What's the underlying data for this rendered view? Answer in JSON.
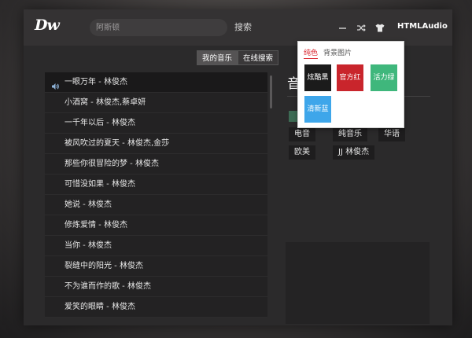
{
  "header": {
    "logo": "Dw",
    "search_placeholder": "阿斯顿",
    "search_button": "搜索",
    "brand": "HTMLAudio",
    "icons": [
      "minimize-icon",
      "shuffle-icon",
      "skin-shirt-icon"
    ]
  },
  "tabs": {
    "my_music": "我的音乐",
    "online_search": "在线搜索"
  },
  "songs": [
    "一眼万年 - 林俊杰",
    "小酒窝 - 林俊杰,蔡卓妍",
    "一千年以后 - 林俊杰",
    "被风吹过的夏天 - 林俊杰,金莎",
    "那些你很冒险的梦 - 林俊杰",
    "可惜没如果 - 林俊杰",
    "她说 - 林俊杰",
    "修炼爱情 - 林俊杰",
    "当你 - 林俊杰",
    "裂缝中的阳光 - 林俊杰",
    "不为谁而作的歌 - 林俊杰",
    "爱笑的眼睛 - 林俊杰"
  ],
  "right": {
    "heading": "音",
    "tags": [
      "电音",
      "纯音乐",
      "华语",
      "欧美",
      "JJ 林俊杰"
    ]
  },
  "skin_popup": {
    "tab_solid": "纯色",
    "tab_bg_image": "背景图片",
    "swatches": [
      {
        "label": "炫酷黑",
        "color": "#1b1b1b"
      },
      {
        "label": "官方红",
        "color": "#c9252c"
      },
      {
        "label": "活力绿",
        "color": "#3fb77c"
      },
      {
        "label": "清新蓝",
        "color": "#3ea6ea"
      }
    ],
    "accent": "#d9232c"
  }
}
